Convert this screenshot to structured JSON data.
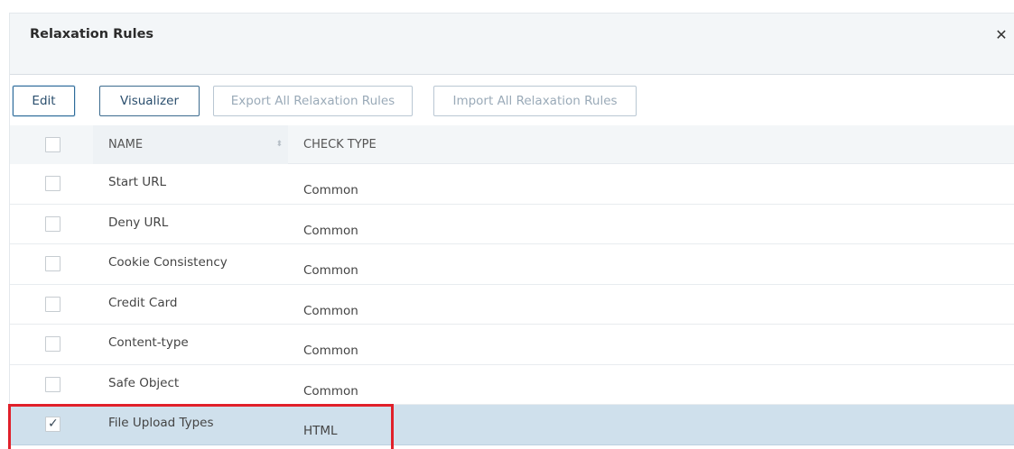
{
  "dialog": {
    "title": "Relaxation Rules",
    "close_symbol": "✕"
  },
  "toolbar": {
    "edit_label": "Edit",
    "visualizer_label": "Visualizer",
    "export_label": "Export All Relaxation Rules",
    "import_label": "Import All Relaxation Rules"
  },
  "table": {
    "columns": {
      "name": "NAME",
      "check_type": "CHECK TYPE"
    },
    "rows": [
      {
        "name": "Start URL",
        "check_type": "Common",
        "selected": false
      },
      {
        "name": "Deny URL",
        "check_type": "Common",
        "selected": false
      },
      {
        "name": "Cookie Consistency",
        "check_type": "Common",
        "selected": false
      },
      {
        "name": "Credit Card",
        "check_type": "Common",
        "selected": false
      },
      {
        "name": "Content-type",
        "check_type": "Common",
        "selected": false
      },
      {
        "name": "Safe Object",
        "check_type": "Common",
        "selected": false
      },
      {
        "name": "File Upload Types",
        "check_type": "HTML",
        "selected": true
      }
    ]
  },
  "colors": {
    "selected_row": "#cfe0ec",
    "header_bg": "#f3f6f8",
    "highlight_border": "#e0202a",
    "button_border": "#3c6b8e"
  },
  "icons": {
    "close": "close-icon",
    "sort": "sort-icon",
    "check": "checkmark-icon"
  }
}
